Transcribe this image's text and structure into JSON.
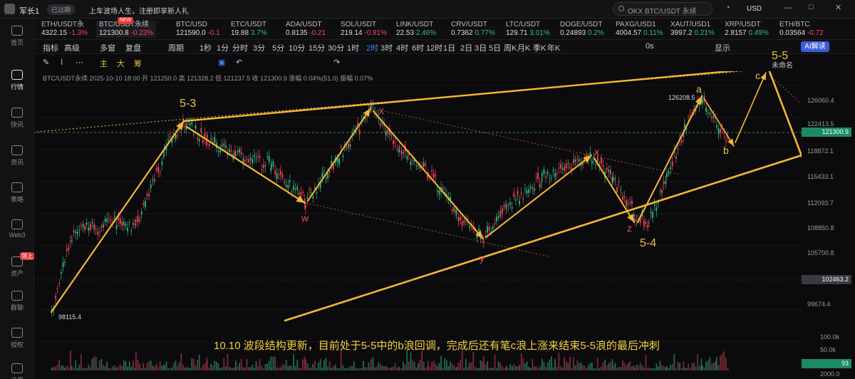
{
  "top": {
    "user": "军长1",
    "status": "已过期",
    "marquee": "上车波场人生，注册即享新人礼",
    "search_placeholder": "OKX BTC/USDT 永续",
    "currency": "USD"
  },
  "sidebar": [
    {
      "label": "首页"
    },
    {
      "label": "行情"
    },
    {
      "label": "快讯"
    },
    {
      "label": "资讯"
    },
    {
      "label": "策略"
    },
    {
      "label": "Web3"
    },
    {
      "label": "资产",
      "badge": "领上"
    },
    {
      "label": "群聊"
    },
    {
      "label": "授权"
    },
    {
      "label": "设置"
    }
  ],
  "tickers": [
    {
      "name": "ETH/USDT永",
      "price": "4322.15",
      "chg": "-1.3%",
      "dir": "dn"
    },
    {
      "name": "BTC/USDT永续",
      "price": "121300.8",
      "chg": "-0.23%",
      "dir": "dn",
      "badge": "NEW"
    },
    {
      "name": "BTC/USD",
      "price": "121590.0",
      "chg": "-0.1",
      "dir": "dn"
    },
    {
      "name": "ETC/USDT",
      "price": "19.88",
      "chg": "3.7%",
      "dir": "up"
    },
    {
      "name": "ADA/USDT",
      "price": "0.8135",
      "chg": "-0.21",
      "dir": "dn"
    },
    {
      "name": "SOL/USDT",
      "price": "219.14",
      "chg": "-0.81%",
      "dir": "dn"
    },
    {
      "name": "LINK/USDT",
      "price": "22.53",
      "chg": "2.46%",
      "dir": "up"
    },
    {
      "name": "CRV/USDT",
      "price": "0.7362",
      "chg": "0.77%",
      "dir": "up"
    },
    {
      "name": "LTC/USDT",
      "price": "129.71",
      "chg": "3.01%",
      "dir": "up"
    },
    {
      "name": "DOGE/USDT",
      "price": "0.24893",
      "chg": "0.2%",
      "dir": "up"
    },
    {
      "name": "PAXG/USD1",
      "price": "4004.57",
      "chg": "0.11%",
      "dir": "up"
    },
    {
      "name": "XAUT/USD1",
      "price": "3997.2",
      "chg": "0.21%",
      "dir": "up"
    },
    {
      "name": "XRP/USDT",
      "price": "2.8157",
      "chg": "0.49%",
      "dir": "up"
    },
    {
      "name": "ETH/BTC",
      "price": "0.03564",
      "chg": "-0.72",
      "dir": "dn"
    }
  ],
  "toolbar": {
    "items": [
      "指标",
      "高级",
      "多窗",
      "复盘",
      "周期",
      "1秒",
      "1分",
      "分时",
      "3分",
      "5分",
      "10分",
      "15分",
      "30分",
      "1时",
      "2时",
      "3时",
      "4时",
      "6时",
      "12时",
      "1日",
      "2日",
      "3日",
      "5日",
      "周K",
      "月K",
      "季K",
      "年K"
    ],
    "selected": "2时",
    "right": [
      "0s",
      "显示",
      "AI解读"
    ]
  },
  "toolbar2": {
    "items": [
      "主",
      "大",
      "筹"
    ],
    "right": "未命名"
  },
  "infoline": "BTC/USDT永续  2025-10-10 18:00  开 121250.0  高 121328.2  低 121237.5  收 121300.9  涨幅 0.04%(51.0)  振幅 0.07%",
  "axis": {
    "ticks": [
      "126060.4",
      "122413.5",
      "118872.1",
      "115433.1",
      "112093.7",
      "108850.8",
      "105700.8",
      "99674.4"
    ],
    "volume_ticks": [
      "100.0k",
      "50.0k",
      "2000.0"
    ],
    "current": "121300.9",
    "crosshair": "102463.2",
    "volume_tag": "93"
  },
  "price_labels": {
    "high": "126208.5",
    "low": "98115.4"
  },
  "waves": {
    "w53": "5-3",
    "w54": "5-4",
    "w55": "5-5",
    "w": "w",
    "x1": "x",
    "y": "y",
    "x2": "x",
    "z": "z",
    "a": "a",
    "b": "b",
    "c": "c"
  },
  "caption": "10.10  波段结构更新，目前处于5-5中的b浪回调，完成后还有笔c浪上涨来结束5-5浪的最后冲刺",
  "chart_data": {
    "type": "line",
    "title": "BTC/USDT永续",
    "wave_points": [
      {
        "label": "",
        "price": 98115.4
      },
      {
        "label": "5-3",
        "price": 122300
      },
      {
        "label": "w",
        "price": 112600
      },
      {
        "label": "x",
        "price": 124100
      },
      {
        "label": "y",
        "price": 107800
      },
      {
        "label": "x",
        "price": 117200
      },
      {
        "label": "z",
        "price": 109000
      },
      {
        "label": "a",
        "price": 126208.5
      },
      {
        "label": "b",
        "price": 119500
      },
      {
        "label": "c",
        "price": 127000
      }
    ]
  }
}
